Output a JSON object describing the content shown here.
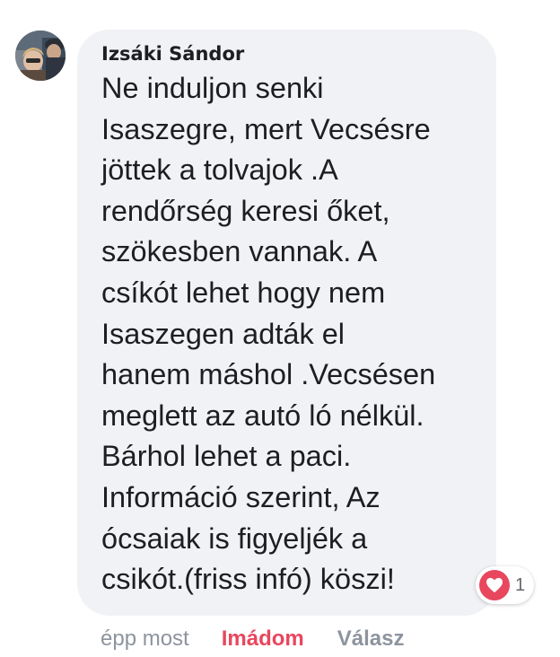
{
  "comment": {
    "author": "Izsáki Sándor",
    "text_lines": [
      "Ne induljon senki",
      "Isaszegre, mert Vecsésre",
      "jöttek a tolvajok .A",
      "rendőrség keresi őket,",
      "szökesben vannak. A",
      "csíkót lehet hogy nem",
      "Isaszegen adták el",
      "hanem máshol .Vecsésen",
      "meglett az autó ló nélkül.",
      "Bárhol lehet a paci.",
      "Információ szerint, Az",
      "ócsaiak is figyeljék a",
      "csikót.(friss infó) köszi!"
    ],
    "reactions": {
      "icon": "heart-icon",
      "count": "1",
      "color": "#e8475e"
    }
  },
  "actions": {
    "timestamp": "épp most",
    "love_label": "Imádom",
    "reply_label": "Válasz"
  },
  "colors": {
    "bubble_bg": "#f0f2f5",
    "text": "#1c1e21",
    "muted": "#8d949e",
    "love": "#e8475e"
  }
}
